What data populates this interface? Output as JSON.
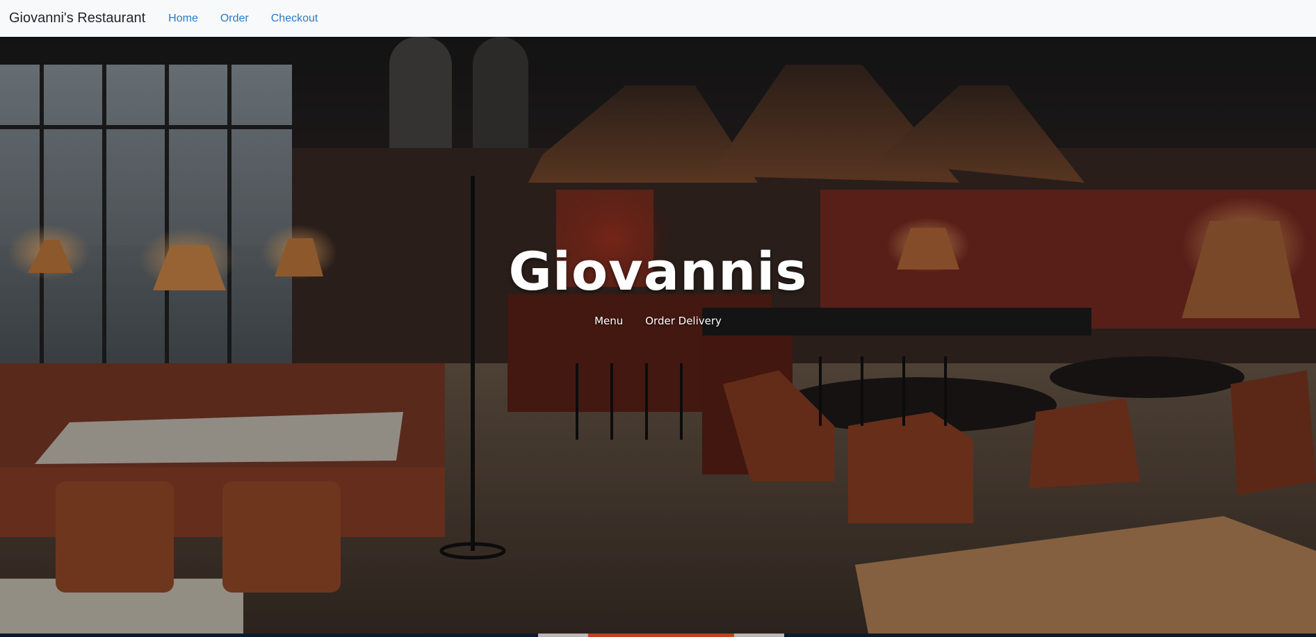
{
  "navbar": {
    "brand": "Giovanni's Restaurant",
    "links": [
      {
        "label": "Home"
      },
      {
        "label": "Order"
      },
      {
        "label": "Checkout"
      }
    ]
  },
  "hero": {
    "title": "Giovannis",
    "links": [
      {
        "label": "Menu"
      },
      {
        "label": "Order Delivery"
      }
    ]
  },
  "colors": {
    "navbar_bg": "#f8f9fa",
    "link": "#2a7ac6",
    "hero_text": "#ffffff"
  }
}
